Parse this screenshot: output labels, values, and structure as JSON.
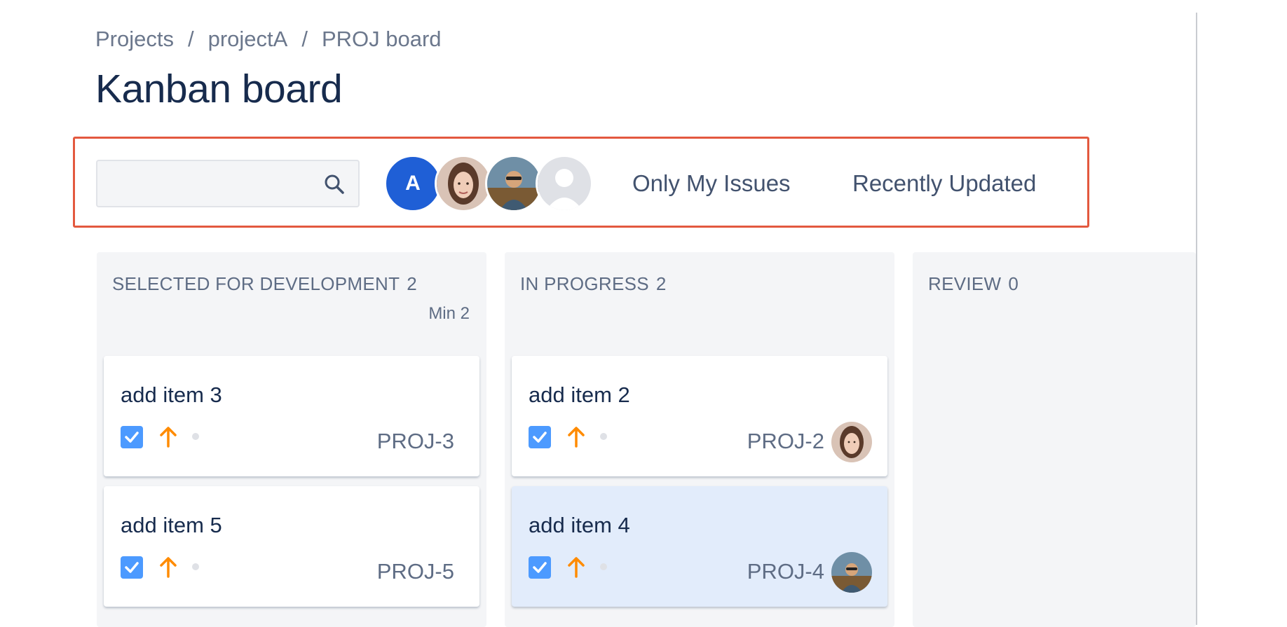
{
  "breadcrumb": {
    "items": [
      "Projects",
      "projectA",
      "PROJ board"
    ],
    "separator": "/"
  },
  "page": {
    "title": "Kanban board"
  },
  "toolbar": {
    "search": {
      "value": "",
      "placeholder": ""
    },
    "avatars": [
      {
        "initial": "A",
        "color": "#1f5fd6"
      },
      {
        "kind": "photo-woman"
      },
      {
        "kind": "photo-man-outdoors"
      },
      {
        "kind": "unassigned-default"
      }
    ],
    "filters": [
      "Only My Issues",
      "Recently Updated"
    ],
    "highlight_color": "#e3593f"
  },
  "columns": [
    {
      "name": "SELECTED FOR DEVELOPMENT",
      "count": "2",
      "min": "Min 2",
      "cards": [
        {
          "title": "add item 3",
          "key": "PROJ-3",
          "type_icon": "checkbox-icon",
          "priority_icon": "arrow-up-icon"
        },
        {
          "title": "add item 5",
          "key": "PROJ-5",
          "type_icon": "checkbox-icon",
          "priority_icon": "arrow-up-icon"
        }
      ]
    },
    {
      "name": "IN PROGRESS",
      "count": "2",
      "cards": [
        {
          "title": "add item 2",
          "key": "PROJ-2",
          "type_icon": "checkbox-icon",
          "priority_icon": "arrow-up-icon",
          "assignee": "photo-woman"
        },
        {
          "title": "add item 4",
          "key": "PROJ-4",
          "type_icon": "checkbox-icon",
          "priority_icon": "arrow-up-icon",
          "assignee": "photo-man-outdoors",
          "selected": true
        }
      ]
    },
    {
      "name": "REVIEW",
      "count": "0",
      "cards": []
    }
  ],
  "colors": {
    "task_blue": "#4c9aff",
    "priority_orange": "#ff8b00",
    "selected_card": "#e2ecfb"
  }
}
